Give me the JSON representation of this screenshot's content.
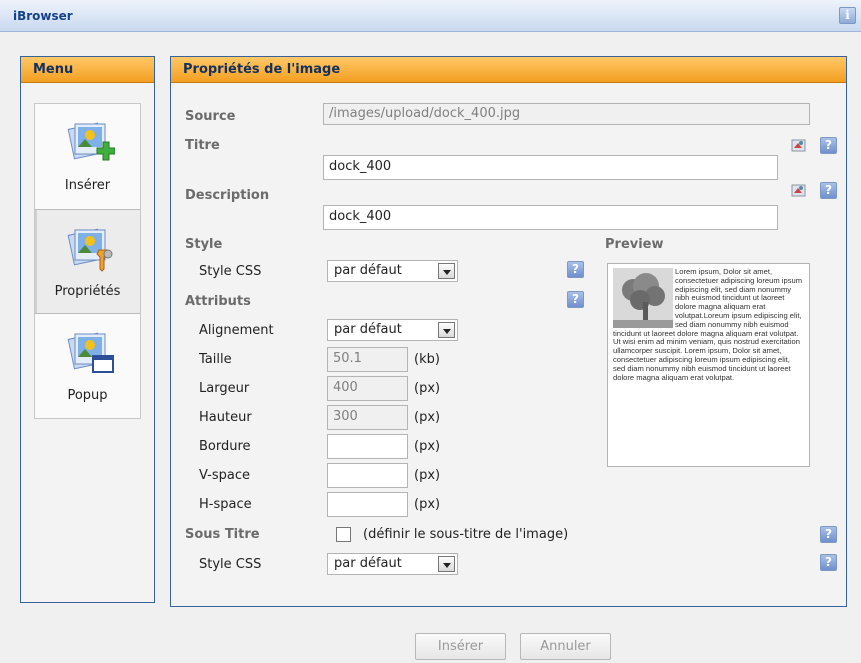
{
  "window": {
    "title": "iBrowser",
    "info_label": "i"
  },
  "menu": {
    "header": "Menu",
    "items": [
      {
        "label": "Insérer",
        "icon": "insert-image-icon"
      },
      {
        "label": "Propriétés",
        "icon": "properties-image-icon"
      },
      {
        "label": "Popup",
        "icon": "popup-image-icon"
      }
    ]
  },
  "properties": {
    "header": "Propriétés de l'image",
    "source_label": "Source",
    "source_value": "/images/upload/dock_400.jpg",
    "titre_label": "Titre",
    "titre_value": "dock_400",
    "description_label": "Description",
    "description_value": "dock_400",
    "style_label": "Style",
    "style_css_label": "Style CSS",
    "style_css_value": "par défaut",
    "attributs_label": "Attributs",
    "alignement_label": "Alignement",
    "alignement_value": "par défaut",
    "taille_label": "Taille",
    "taille_value": "50.1",
    "taille_unit": "(kb)",
    "largeur_label": "Largeur",
    "largeur_value": "400",
    "largeur_unit": "(px)",
    "hauteur_label": "Hauteur",
    "hauteur_value": "300",
    "hauteur_unit": "(px)",
    "bordure_label": "Bordure",
    "bordure_value": "",
    "bordure_unit": "(px)",
    "vspace_label": "V-space",
    "vspace_value": "",
    "vspace_unit": "(px)",
    "hspace_label": "H-space",
    "hspace_value": "",
    "hspace_unit": "(px)",
    "sous_titre_label": "Sous Titre",
    "sous_titre_checkbox_label": "(définir le sous-titre de l'image)",
    "sous_titre_style_label": "Style CSS",
    "sous_titre_style_value": "par défaut",
    "help_label": "?",
    "preview_label": "Preview",
    "preview_text": "Lorem ipsum, Dolor sit amet, consectetuer adipiscing loreum ipsum edipiscing elit, sed diam nonummy nibh euismod tincidunt ut laoreet dolore magna aliquam erat volutpat.Loreum ipsum edipiscing elit, sed diam nonummy nibh euismod tincidunt ut laoreet dolore magna aliquam erat volutpat. Ut wisi enim ad minim veniam, quis nostrud exercitation ullamcorper suscipit. Lorem ipsum, Dolor sit amet, consectetuer adipiscing loreum ipsum edipiscing elit, sed diam nonummy nibh euismod tincidunt ut laoreet dolore magna aliquam erat volutpat."
  },
  "footer": {
    "insert_label": "Insérer",
    "cancel_label": "Annuler"
  },
  "colors": {
    "header_orange": "#f39f20",
    "panel_border": "#37629a",
    "title_blue": "#15428b"
  }
}
